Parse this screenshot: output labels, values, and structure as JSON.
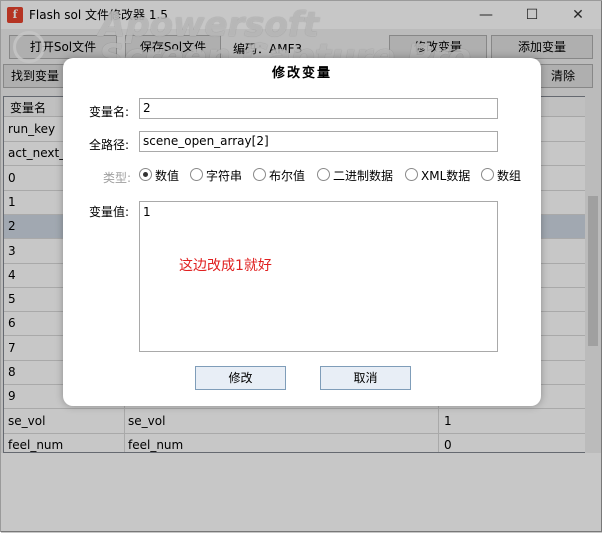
{
  "window": {
    "title": "Flash sol 文件修改器 1.5",
    "app_icon_glyph": "f",
    "minimize_glyph": "—",
    "maximize_glyph": "☐",
    "close_glyph": "✕"
  },
  "watermark": {
    "line1": "Apowersoft",
    "line2": "Screen Capture Pro"
  },
  "toolbar": {
    "open_label": "打开Sol文件",
    "save_label": "保存Sol文件",
    "encoding_label": "编码：AMF3",
    "modify_var_label": "修改变量",
    "add_var_label": "添加变量",
    "find_var_label": "找到变量",
    "clear_label": "清除"
  },
  "table": {
    "columns": [
      "变量名"
    ],
    "rows": [
      {
        "name": "run_key",
        "value": "",
        "extra": ""
      },
      {
        "name": "act_next_m",
        "value": "",
        "extra": ""
      },
      {
        "name": "0",
        "value": "",
        "extra": ""
      },
      {
        "name": "1",
        "value": "",
        "extra": ""
      },
      {
        "name": "2",
        "value": "",
        "extra": "",
        "selected": true
      },
      {
        "name": "3",
        "value": "",
        "extra": ""
      },
      {
        "name": "4",
        "value": "",
        "extra": ""
      },
      {
        "name": "5",
        "value": "",
        "extra": ""
      },
      {
        "name": "6",
        "value": "",
        "extra": ""
      },
      {
        "name": "7",
        "value": "",
        "extra": ""
      },
      {
        "name": "8",
        "value": "",
        "extra": ""
      },
      {
        "name": "9",
        "value": "",
        "extra": ""
      },
      {
        "name": "se_vol",
        "value": "se_vol",
        "extra": "1"
      },
      {
        "name": "feel_num",
        "value": "feel_num",
        "extra": "0"
      }
    ]
  },
  "dialog": {
    "title": "修改变量",
    "var_name_label": "变量名:",
    "var_name_value": "2",
    "full_path_label": "全路径:",
    "full_path_value": "scene_open_array[2]",
    "type_label": "类型:",
    "types": [
      "数值",
      "字符串",
      "布尔值",
      "二进制数据",
      "XML数据",
      "数组"
    ],
    "selected_type": "数值",
    "var_value_label": "变量值:",
    "var_value": "1",
    "annotation": "这边改成1就好",
    "ok_label": "修改",
    "cancel_label": "取消"
  }
}
